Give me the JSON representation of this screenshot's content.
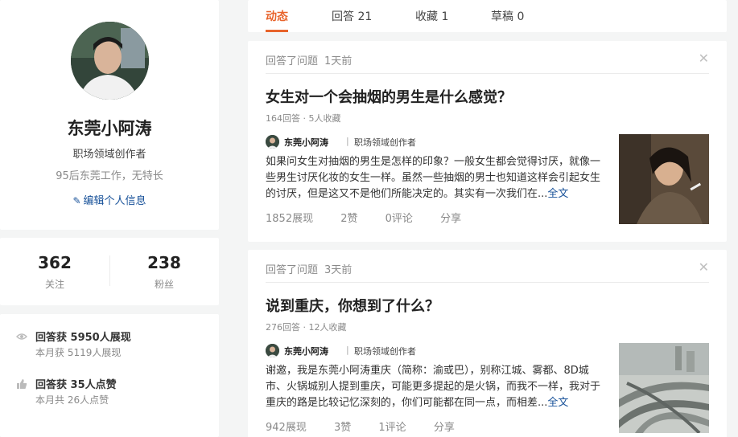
{
  "profile": {
    "name": "东莞小阿涛",
    "role": "职场领域创作者",
    "bio": "95后东莞工作，无特长",
    "edit_label": "编辑个人信息"
  },
  "stats": {
    "following_count": "362",
    "following_label": "关注",
    "followers_count": "238",
    "followers_label": "粉丝"
  },
  "achievements": [
    {
      "icon": "eye-icon",
      "title": "回答获 5950人展现",
      "sub": "本月获 5119人展现"
    },
    {
      "icon": "thumbs-up-icon",
      "title": "回答获 35人点赞",
      "sub": "本月共 26人点赞"
    }
  ],
  "tabs": [
    {
      "label": "动态"
    },
    {
      "label": "回答 21"
    },
    {
      "label": "收藏 1"
    },
    {
      "label": "草稿 0"
    }
  ],
  "feed": [
    {
      "action": "回答了问题",
      "time": "1天前",
      "title": "女生对一个会抽烟的男生是什么感觉？",
      "meta": "164回答 · 5人收藏",
      "author_name": "东莞小阿涛",
      "author_sep": "|",
      "author_role": "职场领域创作者",
      "excerpt": "如果问女生对抽烟的男生是怎样的印象？一般女生都会觉得讨厌，就像一些男生讨厌化妆的女生一样。虽然一些抽烟的男士也知道这样会引起女生的讨厌，但是这又不是他们所能决定的。其实有一次我们在...",
      "more": "全文",
      "views": "1852展现",
      "likes": "2赞",
      "comments": "0评论",
      "share": "分享"
    },
    {
      "action": "回答了问题",
      "time": "3天前",
      "title": "说到重庆，你想到了什么？",
      "meta": "276回答 · 12人收藏",
      "author_name": "东莞小阿涛",
      "author_sep": "|",
      "author_role": "职场领域创作者",
      "excerpt": "谢邀，我是东莞小阿涛重庆（简称：渝或巴），别称江城、雾都、8D城市、火锅城别人提到重庆，可能更多提起的是火锅，而我不一样，我对于重庆的路是比较记忆深刻的，你们可能都在同一点，而相差...",
      "more": "全文",
      "views": "942展现",
      "likes": "3赞",
      "comments": "1评论",
      "share": "分享"
    }
  ],
  "colors": {
    "accent": "#e8642c",
    "link": "#175199",
    "muted": "#8a8a8a",
    "background": "#f4f5f5"
  }
}
